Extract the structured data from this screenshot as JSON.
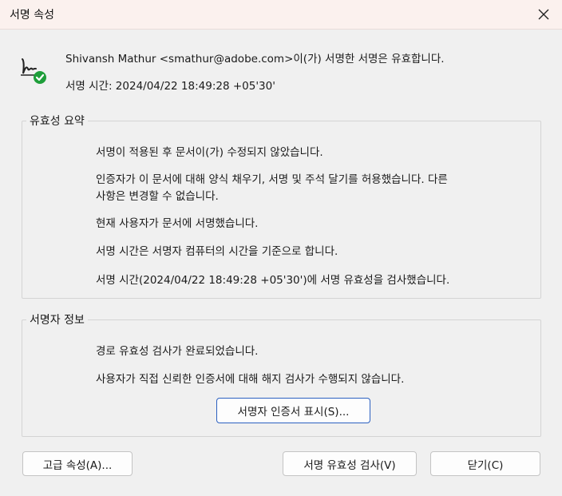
{
  "window": {
    "title": "서명 속성"
  },
  "header": {
    "signer_line": "Shivansh Mathur <smathur@adobe.com>이(가) 서명한 서명은 유효합니다.",
    "time_line": "서명 시간: 2024/04/22 18:49:28 +05'30'"
  },
  "validity": {
    "label": "유효성 요약",
    "lines": [
      "서명이 적용된 후 문서이(가) 수정되지 않았습니다.",
      "인증자가 이 문서에 대해 양식 채우기, 서명 및 주석 달기를 허용했습니다. 다른",
      "사항은 변경할 수 없습니다.",
      "현재 사용자가 문서에 서명했습니다.",
      "서명 시간은 서명자 컴퓨터의 시간을 기준으로 합니다.",
      "서명 시간(2024/04/22 18:49:28 +05'30')에 서명 유효성을 검사했습니다."
    ]
  },
  "signer_info": {
    "label": "서명자 정보",
    "lines": [
      "경로 유효성 검사가 완료되었습니다.",
      "사용자가 직접 신뢰한 인증서에 대해 해지 검사가 수행되지 않습니다."
    ],
    "show_cert_button": "서명자 인증서 표시(S)..."
  },
  "buttons": {
    "advanced": "고급 속성(A)...",
    "validate": "서명 유효성 검사(V)",
    "close": "닫기(C)"
  },
  "colors": {
    "check_green": "#1e9e3a",
    "title_bar": "#fbf1ee"
  },
  "icons": {
    "signature": "signature-check-icon",
    "close": "close-icon"
  }
}
